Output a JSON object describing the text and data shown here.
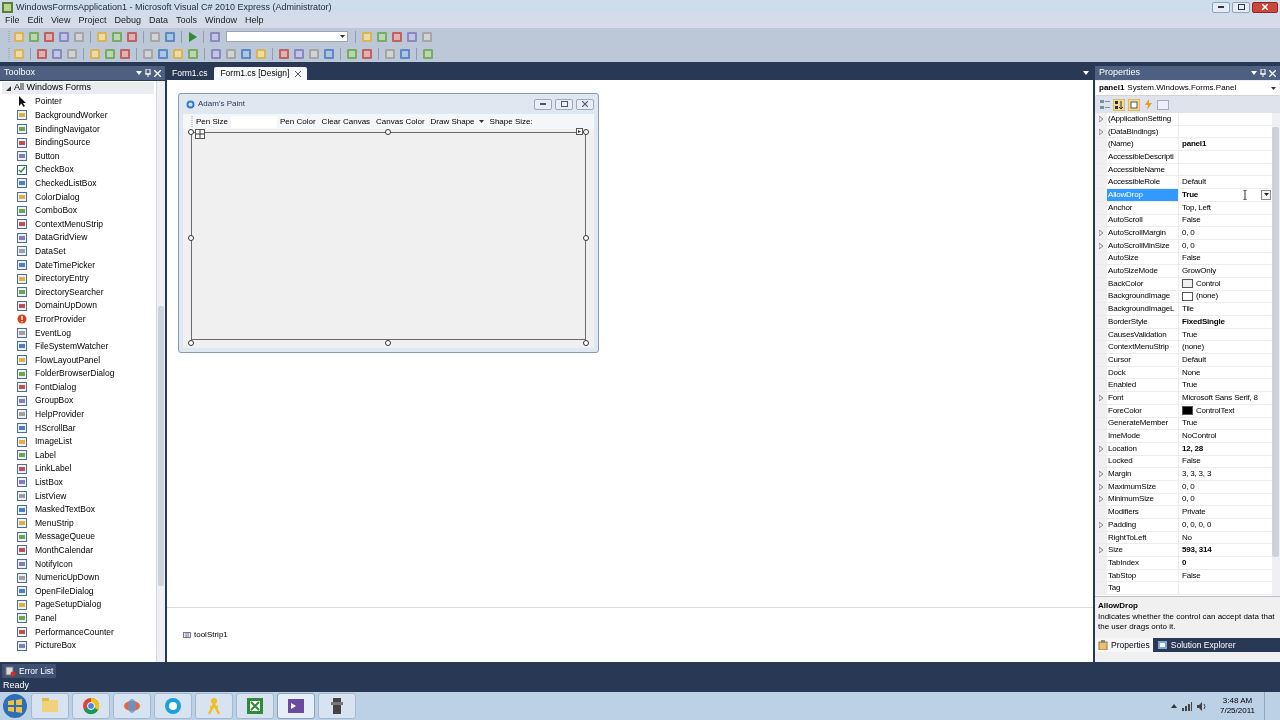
{
  "window": {
    "title": "WindowsFormsApplication1 - Microsoft Visual C# 2010 Express (Administrator)"
  },
  "menu": [
    "File",
    "Edit",
    "View",
    "Project",
    "Debug",
    "Data",
    "Tools",
    "Window",
    "Help"
  ],
  "toolbox": {
    "title": "Toolbox",
    "group": {
      "label": "All Windows Forms",
      "expanded": true
    },
    "items": [
      {
        "label": "Pointer",
        "kind": "pointer"
      },
      {
        "label": "BackgroundWorker",
        "kind": "component"
      },
      {
        "label": "BindingNavigator",
        "kind": "component"
      },
      {
        "label": "BindingSource",
        "kind": "component"
      },
      {
        "label": "Button",
        "kind": "component"
      },
      {
        "label": "CheckBox",
        "kind": "check"
      },
      {
        "label": "CheckedListBox",
        "kind": "component"
      },
      {
        "label": "ColorDialog",
        "kind": "component"
      },
      {
        "label": "ComboBox",
        "kind": "component"
      },
      {
        "label": "ContextMenuStrip",
        "kind": "component"
      },
      {
        "label": "DataGridView",
        "kind": "component"
      },
      {
        "label": "DataSet",
        "kind": "component"
      },
      {
        "label": "DateTimePicker",
        "kind": "component"
      },
      {
        "label": "DirectoryEntry",
        "kind": "component"
      },
      {
        "label": "DirectorySearcher",
        "kind": "component"
      },
      {
        "label": "DomainUpDown",
        "kind": "component"
      },
      {
        "label": "ErrorProvider",
        "kind": "error"
      },
      {
        "label": "EventLog",
        "kind": "component"
      },
      {
        "label": "FileSystemWatcher",
        "kind": "component"
      },
      {
        "label": "FlowLayoutPanel",
        "kind": "component"
      },
      {
        "label": "FolderBrowserDialog",
        "kind": "component"
      },
      {
        "label": "FontDialog",
        "kind": "component"
      },
      {
        "label": "GroupBox",
        "kind": "component"
      },
      {
        "label": "HelpProvider",
        "kind": "component"
      },
      {
        "label": "HScrollBar",
        "kind": "component"
      },
      {
        "label": "ImageList",
        "kind": "component"
      },
      {
        "label": "Label",
        "kind": "component"
      },
      {
        "label": "LinkLabel",
        "kind": "component"
      },
      {
        "label": "ListBox",
        "kind": "component"
      },
      {
        "label": "ListView",
        "kind": "component"
      },
      {
        "label": "MaskedTextBox",
        "kind": "component"
      },
      {
        "label": "MenuStrip",
        "kind": "component"
      },
      {
        "label": "MessageQueue",
        "kind": "component"
      },
      {
        "label": "MonthCalendar",
        "kind": "component"
      },
      {
        "label": "NotifyIcon",
        "kind": "component"
      },
      {
        "label": "NumericUpDown",
        "kind": "component"
      },
      {
        "label": "OpenFileDialog",
        "kind": "component"
      },
      {
        "label": "PageSetupDialog",
        "kind": "component"
      },
      {
        "label": "Panel",
        "kind": "component"
      },
      {
        "label": "PerformanceCounter",
        "kind": "component"
      },
      {
        "label": "PictureBox",
        "kind": "component"
      }
    ]
  },
  "document_tabs": [
    {
      "label": "Form1.cs",
      "selected": false
    },
    {
      "label": "Form1.cs [Design]",
      "selected": true
    }
  ],
  "designer": {
    "form_title": "Adam's Paint",
    "toolstrip_items": [
      {
        "label": "Pen Size",
        "kind": "label"
      },
      {
        "label": "Pen Color",
        "kind": "button"
      },
      {
        "label": "Clear Canvas",
        "kind": "button"
      },
      {
        "label": "Canvas Color",
        "kind": "button"
      },
      {
        "label": "Draw Shape",
        "kind": "dropdown"
      },
      {
        "label": "Shape Size:",
        "kind": "label"
      }
    ],
    "component_tray": [
      "toolStrip1"
    ]
  },
  "properties": {
    "title": "Properties",
    "object_name": "panel1",
    "object_type": "System.Windows.Forms.Panel",
    "rows": [
      {
        "name": "(ApplicationSetting",
        "expandable": true,
        "selected": false
      },
      {
        "name": "(DataBindings)",
        "expandable": true,
        "selected": false
      },
      {
        "name": "(Name)",
        "value": "panel1",
        "expandable": false,
        "bold": true,
        "selected": false
      },
      {
        "name": "AccessibleDescripti",
        "expandable": false,
        "selected": false
      },
      {
        "name": "AccessibleName",
        "expandable": false,
        "selected": false
      },
      {
        "name": "AccessibleRole",
        "value": "Default",
        "expandable": false,
        "bold": false,
        "selected": false
      },
      {
        "name": "AllowDrop",
        "value": "True",
        "expandable": false,
        "bold": true,
        "selected": true
      },
      {
        "name": "Anchor",
        "value": "Top, Left",
        "expandable": false,
        "bold": false,
        "selected": false
      },
      {
        "name": "AutoScroll",
        "value": "False",
        "expandable": false,
        "bold": false,
        "selected": false
      },
      {
        "name": "AutoScrollMargin",
        "value": "0, 0",
        "expandable": true,
        "bold": false,
        "selected": false
      },
      {
        "name": "AutoScrollMinSize",
        "value": "0, 0",
        "expandable": true,
        "bold": false,
        "selected": false
      },
      {
        "name": "AutoSize",
        "value": "False",
        "expandable": false,
        "bold": false,
        "selected": false
      },
      {
        "name": "AutoSizeMode",
        "value": "GrowOnly",
        "expandable": false,
        "bold": false,
        "selected": false
      },
      {
        "name": "BackColor",
        "value": "Control",
        "expandable": false,
        "bold": false,
        "selected": false,
        "color": "#f0f0f0"
      },
      {
        "name": "BackgroundImage",
        "value": "(none)",
        "expandable": false,
        "bold": false,
        "selected": false,
        "color": "#ffffff"
      },
      {
        "name": "BackgroundImageL",
        "value": "Tile",
        "expandable": false,
        "bold": false,
        "selected": false
      },
      {
        "name": "BorderStyle",
        "value": "FixedSingle",
        "expandable": false,
        "bold": true,
        "selected": false
      },
      {
        "name": "CausesValidation",
        "value": "True",
        "expandable": false,
        "bold": false,
        "selected": false
      },
      {
        "name": "ContextMenuStrip",
        "value": "(none)",
        "expandable": false,
        "bold": false,
        "selected": false
      },
      {
        "name": "Cursor",
        "value": "Default",
        "expandable": false,
        "bold": false,
        "selected": false
      },
      {
        "name": "Dock",
        "value": "None",
        "expandable": false,
        "bold": false,
        "selected": false
      },
      {
        "name": "Enabled",
        "value": "True",
        "expandable": false,
        "bold": false,
        "selected": false
      },
      {
        "name": "Font",
        "value": "Microsoft Sans Serif, 8",
        "expandable": true,
        "bold": false,
        "selected": false
      },
      {
        "name": "ForeColor",
        "value": "ControlText",
        "expandable": false,
        "bold": false,
        "selected": false,
        "color": "#000000"
      },
      {
        "name": "GenerateMember",
        "value": "True",
        "expandable": false,
        "bold": false,
        "selected": false
      },
      {
        "name": "ImeMode",
        "value": "NoControl",
        "expandable": false,
        "bold": false,
        "selected": false
      },
      {
        "name": "Location",
        "value": "12, 28",
        "expandable": true,
        "bold": true,
        "selected": false
      },
      {
        "name": "Locked",
        "value": "False",
        "expandable": false,
        "bold": false,
        "selected": false
      },
      {
        "name": "Margin",
        "value": "3, 3, 3, 3",
        "expandable": true,
        "bold": false,
        "selected": false
      },
      {
        "name": "MaximumSize",
        "value": "0, 0",
        "expandable": true,
        "bold": false,
        "selected": false
      },
      {
        "name": "MinimumSize",
        "value": "0, 0",
        "expandable": true,
        "bold": false,
        "selected": false
      },
      {
        "name": "Modifiers",
        "value": "Private",
        "expandable": false,
        "bold": false,
        "selected": false
      },
      {
        "name": "Padding",
        "value": "0, 0, 0, 0",
        "expandable": true,
        "bold": false,
        "selected": false
      },
      {
        "name": "RightToLeft",
        "value": "No",
        "expandable": false,
        "bold": false,
        "selected": false
      },
      {
        "name": "Size",
        "value": "593, 314",
        "expandable": true,
        "bold": true,
        "selected": false
      },
      {
        "name": "TabIndex",
        "value": "0",
        "expandable": false,
        "bold": true,
        "selected": false
      },
      {
        "name": "TabStop",
        "value": "False",
        "expandable": false,
        "bold": false,
        "selected": false
      },
      {
        "name": "Tag",
        "expandable": false,
        "selected": false
      }
    ],
    "description": {
      "title": "AllowDrop",
      "text": "Indicates whether the control can accept data that the user drags onto it."
    }
  },
  "panel_tabs": [
    {
      "label": "Properties",
      "selected": true
    },
    {
      "label": "Solution Explorer",
      "selected": false
    }
  ],
  "bottom_tabs": [
    "Error List"
  ],
  "status": "Ready",
  "clock": {
    "time": "3:48 AM",
    "date": "7/25/2011"
  }
}
